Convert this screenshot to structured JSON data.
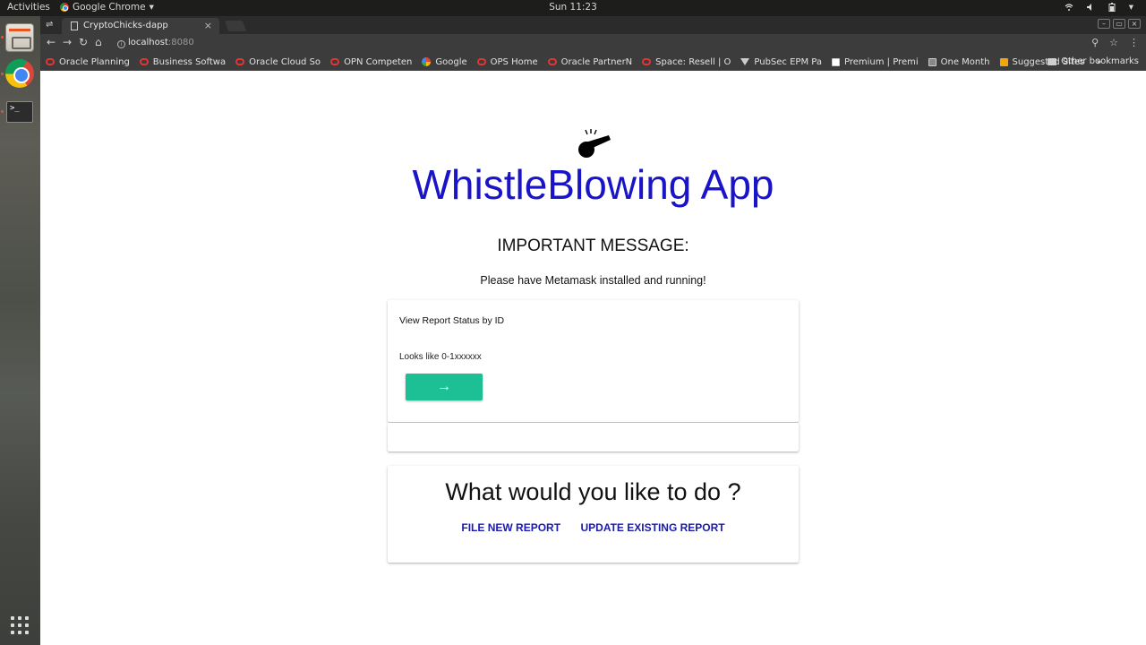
{
  "system": {
    "activities": "Activities",
    "app_menu": "Google Chrome",
    "clock": "Sun 11:23"
  },
  "browser": {
    "tab_title": "CryptoChicks-dapp",
    "url_host": "localhost",
    "url_port": ":8080",
    "bookmarks": [
      {
        "label": "Oracle Planning",
        "icon": "oracle-icon"
      },
      {
        "label": "Business Softwa",
        "icon": "oracle-icon"
      },
      {
        "label": "Oracle Cloud So",
        "icon": "oracle-icon"
      },
      {
        "label": "OPN Competen",
        "icon": "oracle-icon"
      },
      {
        "label": "Google",
        "icon": "google-icon"
      },
      {
        "label": "OPS Home",
        "icon": "oracle-icon"
      },
      {
        "label": "Oracle PartnerN",
        "icon": "oracle-icon"
      },
      {
        "label": "Space: Resell | O",
        "icon": "oracle-icon"
      },
      {
        "label": "PubSec EPM Pa",
        "icon": "triangle-icon"
      },
      {
        "label": "Premium | Premi",
        "icon": "page-icon"
      },
      {
        "label": "One Month",
        "icon": "calendar-icon"
      },
      {
        "label": "Suggested Sites",
        "icon": "suggested-icon"
      }
    ],
    "bookmarks_more": "»",
    "other_bookmarks": "Other bookmarks"
  },
  "page": {
    "title": "WhistleBlowing App",
    "important": "IMPORTANT MESSAGE:",
    "notice": "Please have Metamask installed and running!",
    "status_card": {
      "heading": "View Report Status by ID",
      "input_placeholder": "Looks like 0-1xxxxxx",
      "submit_icon": "→"
    },
    "actions_card": {
      "question": "What would you like to do ?",
      "file_new": "FILE NEW REPORT",
      "update_existing": "UPDATE EXISTING REPORT"
    }
  },
  "colors": {
    "title": "#1a14c8",
    "accent_button": "#1dbf94",
    "link": "#1a1ab0"
  }
}
